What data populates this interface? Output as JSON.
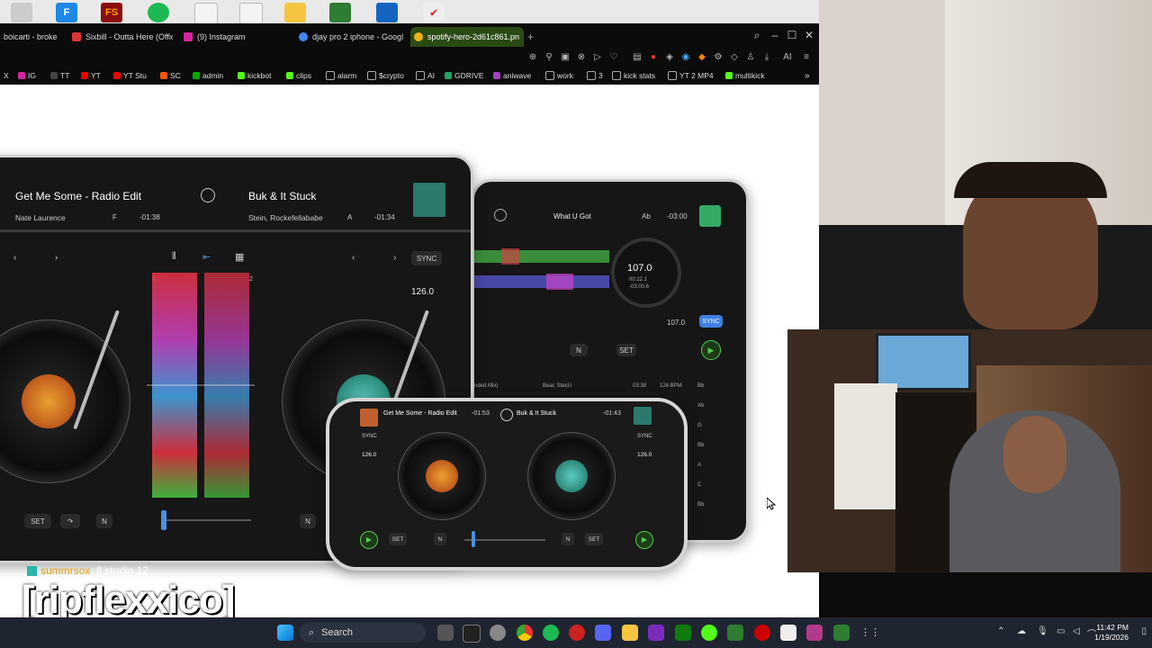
{
  "browser": {
    "tabs": [
      {
        "label": "boicarti - broke",
        "favicon_color": "#888"
      },
      {
        "label": "Sixbill - Outta Here (Offici",
        "favicon_color": "#d33"
      },
      {
        "label": "(9) Instagram",
        "favicon_color": "#d6249f"
      },
      {
        "label": "djay pro 2 iphone - Googl",
        "favicon_color": "#4285f4"
      },
      {
        "label": "spotify-hero-2d61c861.pn",
        "favicon_color": "#e7b416"
      }
    ],
    "new_tab": "+",
    "bookmarks": [
      {
        "label": "X",
        "color": "#000"
      },
      {
        "label": "IG",
        "color": "#d6249f"
      },
      {
        "label": "TT",
        "color": "#111"
      },
      {
        "label": "YT",
        "color": "#e00"
      },
      {
        "label": "YT Stu",
        "color": "#e00"
      },
      {
        "label": "SC",
        "color": "#f50"
      },
      {
        "label": "admin",
        "color": "#0a0"
      },
      {
        "label": "kickbot",
        "color": "#53fc18"
      },
      {
        "label": "clips",
        "color": "#53fc18"
      },
      {
        "label": "alarm",
        "color": "#999"
      },
      {
        "label": "$crypto",
        "color": "#999"
      },
      {
        "label": "AI",
        "color": "#999"
      },
      {
        "label": "GDRIVE",
        "color": "#1fa463"
      },
      {
        "label": "aniwave",
        "color": "#a040c0"
      },
      {
        "label": "work",
        "color": "#999"
      },
      {
        "label": "3",
        "color": "#999"
      },
      {
        "label": "kick stats",
        "color": "#999"
      },
      {
        "label": "YT 2 MP4",
        "color": "#999"
      },
      {
        "label": "multikick",
        "color": "#53fc18"
      }
    ]
  },
  "tablet_main": {
    "deck_a": {
      "title": "Get Me Some - Radio Edit",
      "artist": "Nate Laurence",
      "key": "F",
      "time": "-01:38"
    },
    "deck_b": {
      "title": "Buk & It Stuck",
      "artist": "Stein, Rockefellababe",
      "key": "A",
      "time": "-01:34"
    },
    "bpm": "126.0",
    "sync": "SYNC",
    "set": "SET",
    "deck_marker": "N",
    "channel_1": "1",
    "channel_2": "2"
  },
  "tablet_back": {
    "track": "What U Got",
    "key": "Ab",
    "time": "-03:00",
    "bpm_big": "107.0",
    "elapsed": "00:22.1",
    "remaining": "-03:00.6",
    "bpm_small": "107.0",
    "sync": "SYNC",
    "set": "SET",
    "deck_marker": "N",
    "library_row": {
      "title": "nded Mix)",
      "artist": "Bear, StecU",
      "time": "03:38",
      "bpm": "124 BPM",
      "key": "Bb"
    },
    "keys": [
      "Ab",
      "G",
      "Bb",
      "A",
      "C",
      "Bb"
    ]
  },
  "phone": {
    "deck_a": {
      "title": "Get Me Some - Radio Edit",
      "time": "-01:53"
    },
    "deck_b": {
      "title": "Buk & It Stuck",
      "time": "-01:43"
    },
    "sync": "SYNC",
    "bpm": "126.0",
    "set": "SET",
    "deck_marker": "N"
  },
  "stream": {
    "chat_user": "summrsox",
    "chat_message": ": fl studio 12",
    "channel_name": "[ripflexxico]"
  },
  "taskbar": {
    "search_label": "Search",
    "time": "11:42 PM",
    "date": "1/19/2026"
  }
}
